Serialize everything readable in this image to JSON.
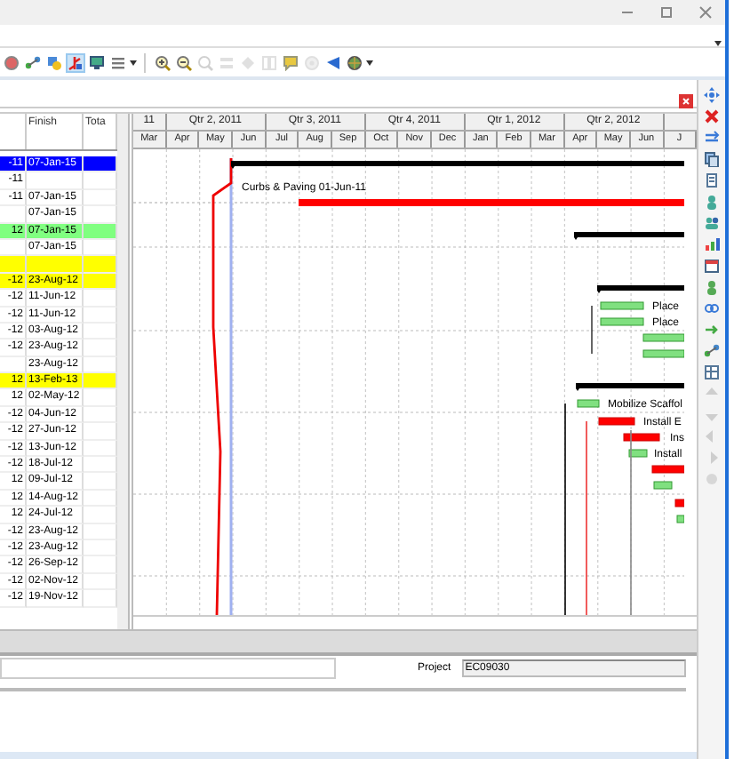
{
  "toolbar": {
    "items": [
      {
        "selected": false,
        "disabled": false
      },
      {
        "selected": false,
        "disabled": false
      },
      {
        "selected": false,
        "disabled": false
      },
      {
        "selected": true,
        "disabled": false
      },
      {
        "selected": false,
        "disabled": false
      },
      {
        "selected": false,
        "disabled": false
      },
      {
        "selected": false,
        "disabled": false
      },
      {
        "selected": false,
        "disabled": false
      },
      {
        "selected": false,
        "disabled": true
      },
      {
        "selected": false,
        "disabled": true
      },
      {
        "selected": false,
        "disabled": true
      },
      {
        "selected": false,
        "disabled": true
      },
      {
        "selected": false,
        "disabled": false
      },
      {
        "selected": false,
        "disabled": true
      },
      {
        "selected": false,
        "disabled": false
      },
      {
        "selected": false,
        "disabled": false
      }
    ]
  },
  "table": {
    "columns": [
      "Finish",
      "Tota"
    ],
    "rows": [
      {
        "column_1": "-11",
        "finish": "07-Jan-15",
        "selected": true
      },
      {
        "column_1": "-11",
        "finish": "",
        "selected": false
      },
      {
        "column_1": "-11",
        "finish": "07-Jan-15",
        "selected": false
      },
      {
        "column_1": "",
        "finish": "07-Jan-15",
        "selected": false
      },
      {
        "column_1": "12",
        "finish": "07-Jan-15",
        "selected": false,
        "color": "#80ff80"
      },
      {
        "column_1": "",
        "finish": "07-Jan-15",
        "selected": false
      },
      {
        "column_1": "",
        "finish": "",
        "selected": false,
        "color": "#ffff00"
      },
      {
        "column_1": "-12",
        "finish": "23-Aug-12",
        "selected": false,
        "color": "#ffff00"
      },
      {
        "column_1": "-12",
        "finish": "11-Jun-12",
        "selected": false
      },
      {
        "column_1": "-12",
        "finish": "11-Jun-12",
        "selected": false
      },
      {
        "column_1": "-12",
        "finish": "03-Aug-12",
        "selected": false
      },
      {
        "column_1": "-12",
        "finish": "23-Aug-12",
        "selected": false
      },
      {
        "column_1": "",
        "finish": "23-Aug-12",
        "selected": false
      },
      {
        "column_1": "12",
        "finish": "13-Feb-13",
        "selected": false,
        "color": "#ffff00"
      },
      {
        "column_1": "12",
        "finish": "02-May-12",
        "selected": false
      },
      {
        "column_1": "-12",
        "finish": "04-Jun-12",
        "selected": false
      },
      {
        "column_1": "-12",
        "finish": "27-Jun-12",
        "selected": false
      },
      {
        "column_1": "-12",
        "finish": "13-Jun-12",
        "selected": false
      },
      {
        "column_1": "-12",
        "finish": "18-Jul-12",
        "selected": false
      },
      {
        "column_1": "12",
        "finish": "09-Jul-12",
        "selected": false
      },
      {
        "column_1": "12",
        "finish": "14-Aug-12",
        "selected": false
      },
      {
        "column_1": "12",
        "finish": "24-Jul-12",
        "selected": false
      },
      {
        "column_1": "-12",
        "finish": "23-Aug-12",
        "selected": false
      },
      {
        "column_1": "-12",
        "finish": "23-Aug-12",
        "selected": false
      },
      {
        "column_1": "-12",
        "finish": "26-Sep-12",
        "selected": false
      },
      {
        "column_1": "-12",
        "finish": "02-Nov-12",
        "selected": false
      },
      {
        "column_1": "-12",
        "finish": "19-Nov-12",
        "selected": false
      }
    ]
  },
  "gantt": {
    "quarters": [
      "11",
      "Qtr 2, 2011",
      "Qtr 3, 2011",
      "Qtr 4, 2011",
      "Qtr 1, 2012",
      "Qtr 2, 2012"
    ],
    "months": [
      "Mar",
      "Apr",
      "May",
      "Jun",
      "Jul",
      "Aug",
      "Sep",
      "Oct",
      "Nov",
      "Dec",
      "Jan",
      "Feb",
      "Mar",
      "Apr",
      "May",
      "Jun",
      "J"
    ],
    "bar_labels": [
      "Curbs & Paving 01-Jun-11",
      "Place",
      "Place",
      "Mobilize Scaffol",
      "Install E",
      "Ins",
      "Install"
    ]
  },
  "side_toolbar": {
    "items": [
      {
        "disabled": false
      },
      {
        "disabled": false
      },
      {
        "disabled": false
      },
      {
        "disabled": false
      },
      {
        "disabled": false
      },
      {
        "disabled": false
      },
      {
        "disabled": false
      },
      {
        "disabled": false
      },
      {
        "disabled": false
      },
      {
        "disabled": false
      },
      {
        "disabled": false
      },
      {
        "disabled": false
      },
      {
        "disabled": false
      },
      {
        "disabled": false
      },
      {
        "disabled": true
      },
      {
        "disabled": true
      },
      {
        "disabled": true
      },
      {
        "disabled": true
      },
      {
        "disabled": true
      }
    ]
  },
  "project": {
    "label": "Project",
    "value": "EC09030"
  }
}
